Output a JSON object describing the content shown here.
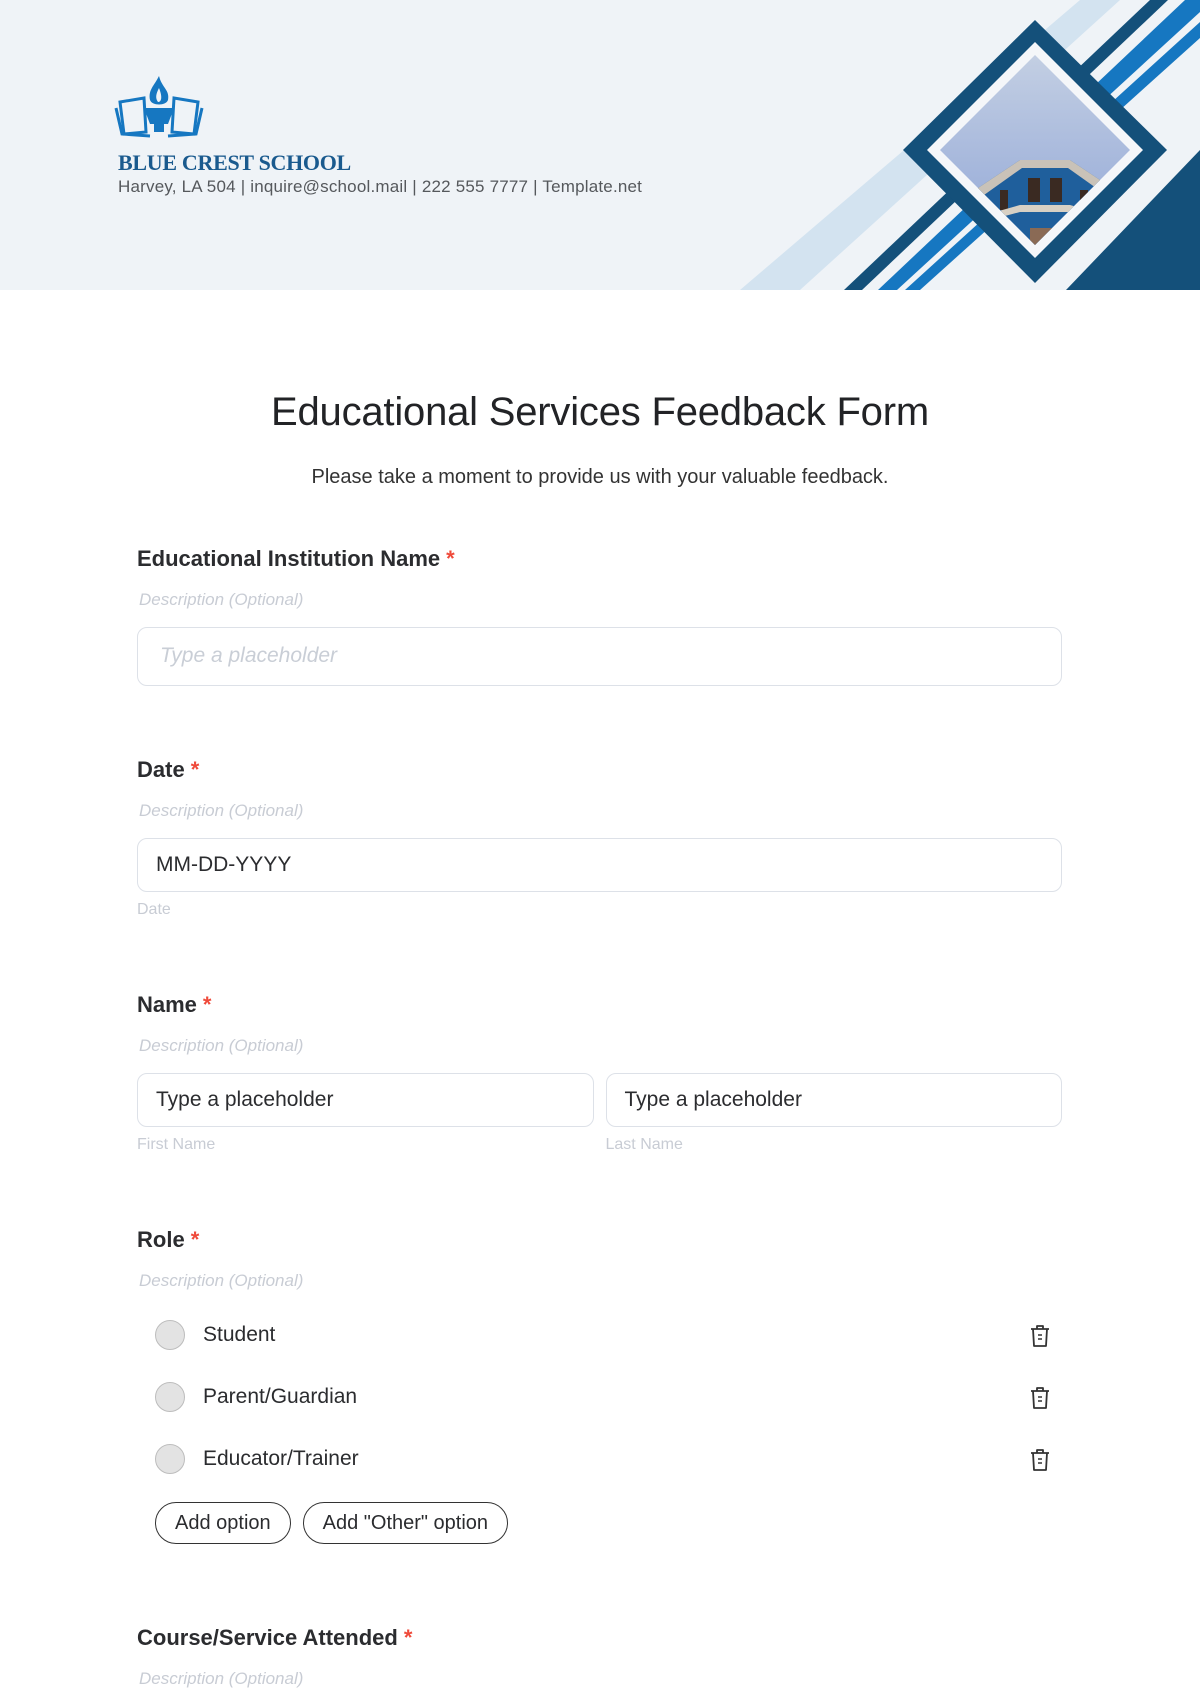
{
  "header": {
    "school_name": "BLUE CREST SCHOOL",
    "contact": "Harvey, LA 504 | inquire@school.mail | 222 555 7777 | Template.net",
    "colors": {
      "dark_blue": "#14507a",
      "mid_blue": "#1677c1",
      "light_blue": "#d3e3f0",
      "background": "#eff3f7"
    }
  },
  "form": {
    "title": "Educational Services Feedback Form",
    "subtitle": "Please take a moment to provide us with your valuable feedback.",
    "required_mark": "*",
    "fields": {
      "institution": {
        "label": "Educational Institution Name",
        "description": "Description (Optional)",
        "placeholder": "Type a placeholder"
      },
      "date": {
        "label": "Date",
        "description": "Description (Optional)",
        "value": "MM-DD-YYYY",
        "sublabel": "Date"
      },
      "name": {
        "label": "Name",
        "description": "Description (Optional)",
        "first": {
          "value": "Type a placeholder",
          "sublabel": "First Name"
        },
        "last": {
          "value": "Type a placeholder",
          "sublabel": "Last Name"
        }
      },
      "role": {
        "label": "Role",
        "description": "Description (Optional)",
        "options": [
          {
            "label": "Student"
          },
          {
            "label": "Parent/Guardian"
          },
          {
            "label": "Educator/Trainer"
          }
        ],
        "add_option": "Add option",
        "add_other_option": "Add \"Other\" option"
      },
      "course": {
        "label": "Course/Service Attended",
        "description": "Description (Optional)"
      }
    }
  }
}
